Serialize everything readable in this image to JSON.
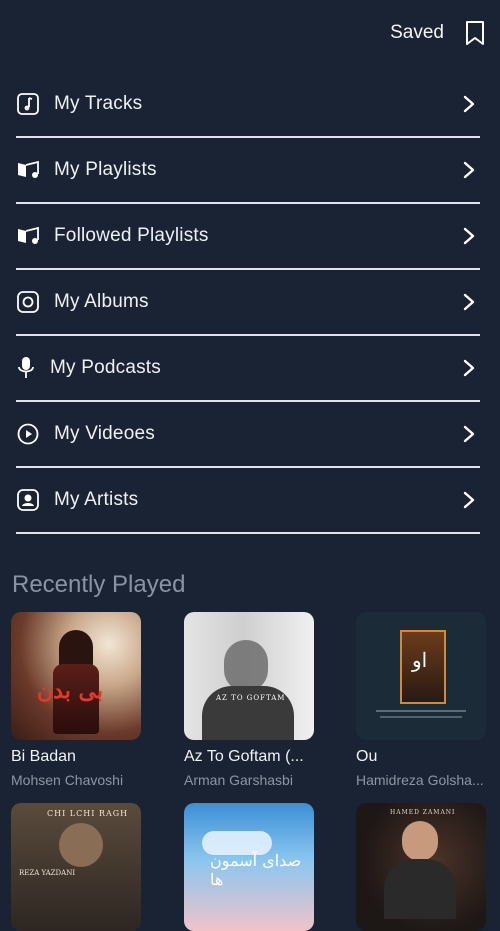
{
  "header": {
    "saved_label": "Saved",
    "bookmark_icon": "bookmark-icon"
  },
  "menu": [
    {
      "label": "My Tracks",
      "icon": "music-note-icon"
    },
    {
      "label": "My Playlists",
      "icon": "playlist-icon"
    },
    {
      "label": "Followed Playlists",
      "icon": "playlist-icon"
    },
    {
      "label": "My Albums",
      "icon": "album-icon"
    },
    {
      "label": "My Podcasts",
      "icon": "microphone-icon"
    },
    {
      "label": "My Videoes",
      "icon": "play-circle-icon"
    },
    {
      "label": "My Artists",
      "icon": "artist-icon"
    }
  ],
  "recent": {
    "title": "Recently Played",
    "items": [
      {
        "title": "Bi Badan",
        "artist": "Mohsen Chavoshi",
        "cover_text": "بی بدن"
      },
      {
        "title": "Az To Goftam (...",
        "artist": "Arman Garshasbi",
        "cover_text": "AZ TO GOFTAM"
      },
      {
        "title": "Ou",
        "artist": "Hamidreza Golsha...",
        "cover_text": "او"
      },
      {
        "title": "",
        "artist": "",
        "cover_text": "CHI LCHI RAGH",
        "cover_sub": "REZA YAZDANI"
      },
      {
        "title": "",
        "artist": "",
        "cover_text": "صدای آسمون ها"
      },
      {
        "title": "",
        "artist": "",
        "cover_text": "HAMED ZAMANI"
      }
    ]
  },
  "colors": {
    "background": "#1a2333",
    "divider": "#dfe3ea",
    "muted": "#8a93a3"
  }
}
